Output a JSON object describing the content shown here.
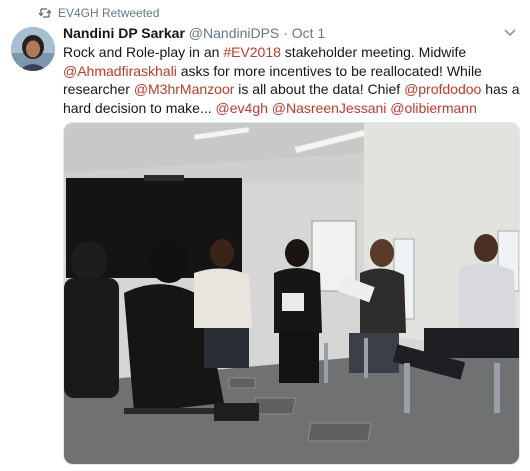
{
  "retweet": {
    "label": "EV4GH Retweeted",
    "icon": "retweet-icon"
  },
  "tweet": {
    "author_name": "Nandini DP Sarkar",
    "author_handle": "@NandiniDPS",
    "separator": "·",
    "date": "Oct 1",
    "text_parts": {
      "p1": "Rock and Role-play in an ",
      "hashtag": "#EV2018",
      "p2": " stakeholder meeting. Midwife ",
      "mention1": "@Ahmadfiraskhali",
      "p3": " asks for more incentives to be reallocated! While researcher ",
      "mention2": "@M3hrManzoor",
      "p4": " is all about the data! Chief ",
      "mention3": "@profdodoo",
      "p5": " has a hard decision to make... ",
      "mention4": "@ev4gh",
      "mention5": "@NasreenJessani",
      "mention6": "@olibiermann"
    }
  },
  "colors": {
    "link": "#c0392b",
    "muted": "#657786",
    "text": "#14171a"
  }
}
